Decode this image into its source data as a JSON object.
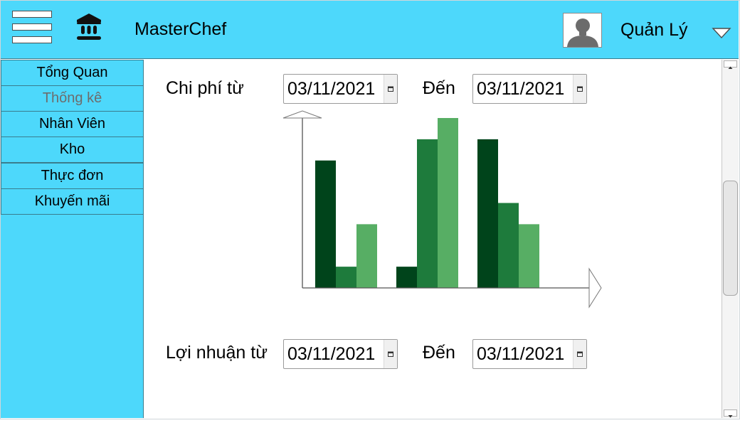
{
  "header": {
    "brand": "MasterChef",
    "user_name": "Quản Lý",
    "menu_icon": "hamburger-icon",
    "logo_icon": "bank-icon",
    "avatar_icon": "user-avatar-icon",
    "dropdown_icon": "chevron-down-icon"
  },
  "sidebar": {
    "items": [
      {
        "label": "Tổng Quan"
      },
      {
        "label": "Thống kê"
      },
      {
        "label": "Nhân Viên"
      },
      {
        "label": "Kho"
      },
      {
        "label": "Thực đơn"
      },
      {
        "label": "Khuyến mãi"
      }
    ],
    "active_index": 1
  },
  "cost_filter": {
    "from_label": "Chi phí từ",
    "from_value": "03/11/2021",
    "to_label": "Đến",
    "to_value": "03/11/2021"
  },
  "profit_filter": {
    "from_label": "Lợi nhuận từ",
    "from_value": "03/11/2021",
    "to_label": "Đến",
    "to_value": "03/11/2021"
  },
  "colors": {
    "header_bg": "#4dd8fb",
    "sidebar_bg": "#4dd8fb",
    "series_dark": "#00441b",
    "series_mid": "#1e7b3c",
    "series_light": "#57ae64"
  },
  "chart_data": {
    "type": "bar",
    "categories": [
      "",
      "",
      ""
    ],
    "series": [
      {
        "values": [
          6,
          1,
          7
        ]
      },
      {
        "values": [
          1,
          7,
          4
        ]
      },
      {
        "values": [
          3,
          8,
          3
        ]
      }
    ],
    "ylim": [
      0,
      8
    ],
    "grid": false
  }
}
